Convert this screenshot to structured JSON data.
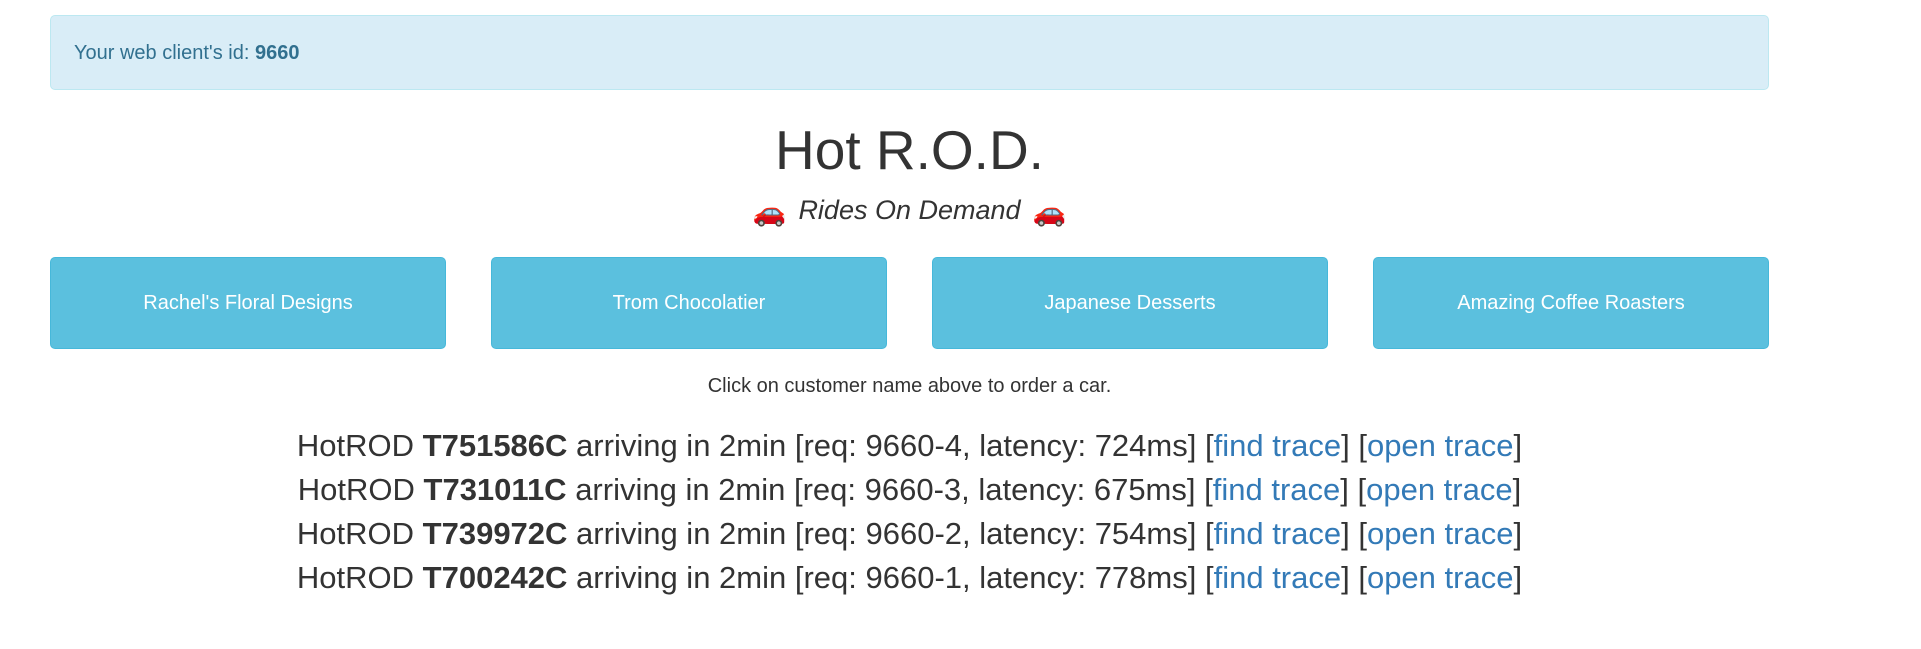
{
  "client": {
    "label": "Your web client's id: ",
    "id": "9660"
  },
  "app": {
    "title": "Hot R.O.D.",
    "subtitle": "Rides On Demand",
    "car_icon": "🚗"
  },
  "customers": [
    {
      "name": "Rachel's Floral Designs"
    },
    {
      "name": "Trom Chocolatier"
    },
    {
      "name": "Japanese Desserts"
    },
    {
      "name": "Amazing Coffee Roasters"
    }
  ],
  "hint": "Click on customer name above to order a car.",
  "rides": [
    {
      "prefix": "HotROD ",
      "car": "T751586C",
      "middle": " arriving in 2min [req: 9660-4, latency: 724ms] [",
      "find": "find trace",
      "sep": "] [",
      "open": "open trace",
      "suffix": "]"
    },
    {
      "prefix": "HotROD ",
      "car": "T731011C",
      "middle": " arriving in 2min [req: 9660-3, latency: 675ms] [",
      "find": "find trace",
      "sep": "] [",
      "open": "open trace",
      "suffix": "]"
    },
    {
      "prefix": "HotROD ",
      "car": "T739972C",
      "middle": " arriving in 2min [req: 9660-2, latency: 754ms] [",
      "find": "find trace",
      "sep": "] [",
      "open": "open trace",
      "suffix": "]"
    },
    {
      "prefix": "HotROD ",
      "car": "T700242C",
      "middle": " arriving in 2min [req: 9660-1, latency: 778ms] [",
      "find": "find trace",
      "sep": "] [",
      "open": "open trace",
      "suffix": "]"
    }
  ],
  "colors": {
    "alert_bg": "#d9edf7",
    "alert_text": "#31708f",
    "button_bg": "#5bc0de",
    "link": "#337ab7"
  }
}
